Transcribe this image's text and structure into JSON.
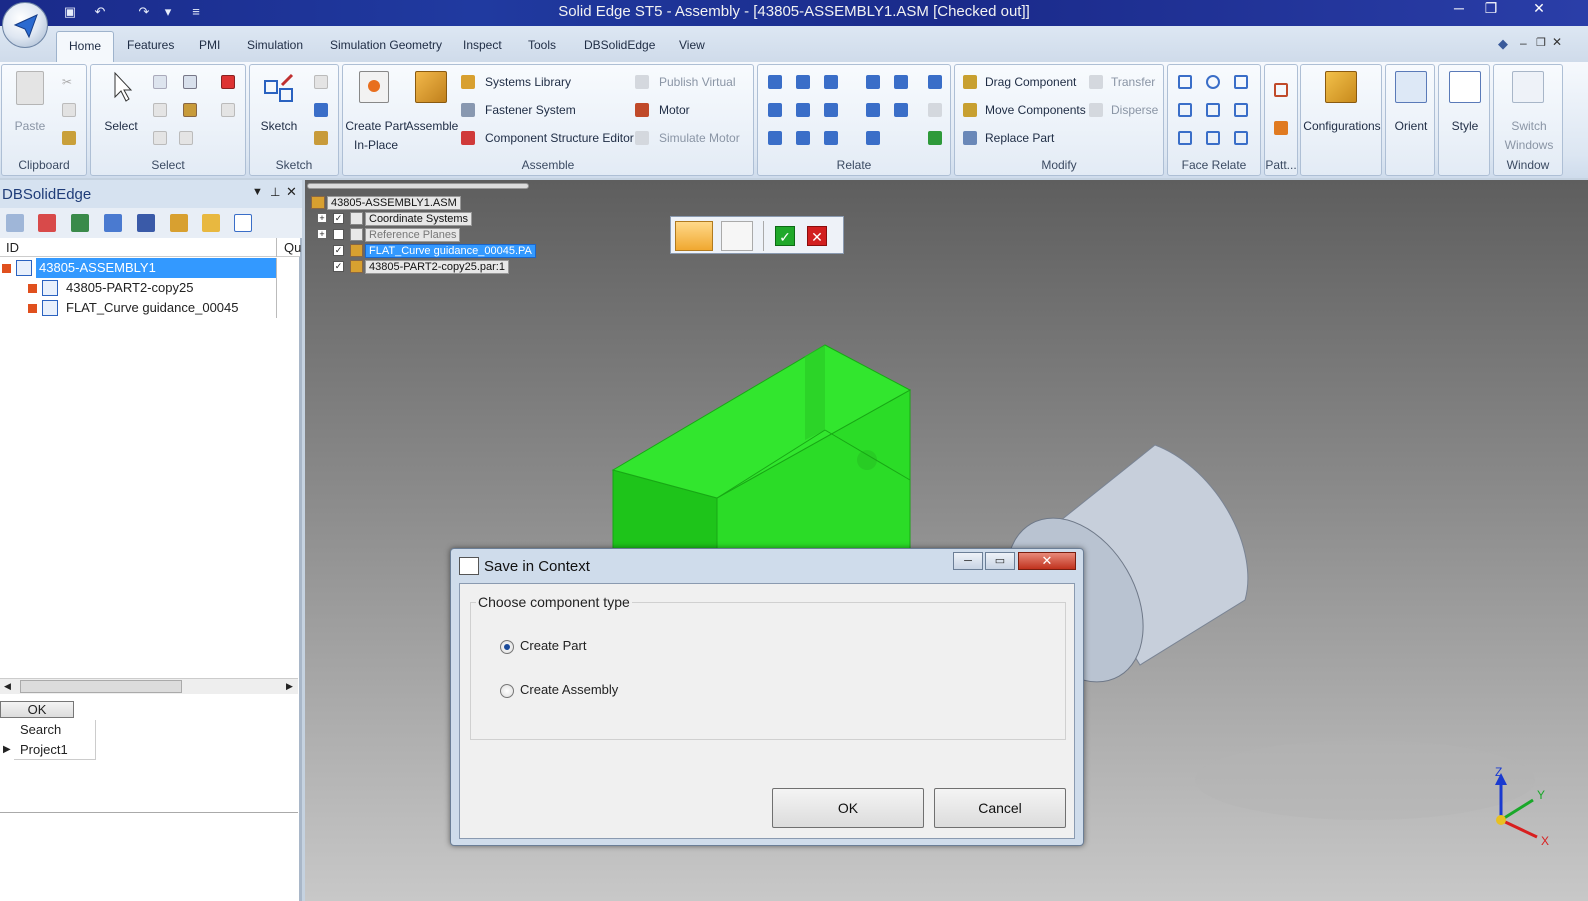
{
  "window": {
    "title": "Solid Edge ST5 - Assembly - [43805-ASSEMBLY1.ASM [Checked out]]"
  },
  "qat": {
    "save_icon": "save-icon",
    "undo_icon": "undo-icon",
    "redo_icon": "redo-icon"
  },
  "tabs": [
    "Home",
    "Features",
    "PMI",
    "Simulation",
    "Simulation Geometry",
    "Inspect",
    "Tools",
    "DBSolidEdge",
    "View"
  ],
  "ribbon": {
    "clipboard": {
      "label": "Clipboard",
      "paste": "Paste"
    },
    "select": {
      "label": "Select",
      "select": "Select"
    },
    "sketch": {
      "label": "Sketch",
      "sketch": "Sketch"
    },
    "assemble": {
      "label": "Assemble",
      "create_part": "Create Part",
      "in_place": "In-Place",
      "assemble": "Assemble",
      "systems_library": "Systems Library",
      "fastener_system": "Fastener System",
      "component_structure_editor": "Component Structure Editor",
      "publish_virtual": "Publish Virtual",
      "motor": "Motor",
      "simulate_motor": "Simulate Motor"
    },
    "relate": {
      "label": "Relate"
    },
    "modify": {
      "label": "Modify",
      "drag_component": "Drag Component",
      "move_components": "Move Components",
      "replace_part": "Replace Part",
      "transfer": "Transfer",
      "disperse": "Disperse"
    },
    "face_relate": {
      "label": "Face Relate"
    },
    "pattern": {
      "label": "Patt..."
    },
    "configurations": "Configurations",
    "orient": "Orient",
    "style": "Style",
    "window": {
      "label": "Window",
      "switch": "Switch",
      "windows": "Windows"
    }
  },
  "left_panel": {
    "title": "DBSolidEdge",
    "col_id": "ID",
    "col_qu": "Qu",
    "rows": [
      "43805-ASSEMBLY1",
      "43805-PART2-copy25",
      "FLAT_Curve guidance_00045"
    ],
    "ok": "OK",
    "search": "Search",
    "project": "Project1"
  },
  "pathfinder": {
    "root": "43805-ASSEMBLY1.ASM",
    "items": [
      "Coordinate Systems",
      "Reference Planes",
      "FLAT_Curve guidance_00045.PA",
      "43805-PART2-copy25.par:1"
    ]
  },
  "triad": {
    "x": "X",
    "y": "Y",
    "z": "Z"
  },
  "dialog": {
    "title": "Save in Context",
    "group": "Choose component type",
    "options": [
      "Create Part",
      "Create Assembly"
    ],
    "selected": "Create Part",
    "ok": "OK",
    "cancel": "Cancel"
  },
  "colors": {
    "selected_part": "#22d11f",
    "cylinder": "#b8c2d0",
    "accent": "#3399ff"
  }
}
